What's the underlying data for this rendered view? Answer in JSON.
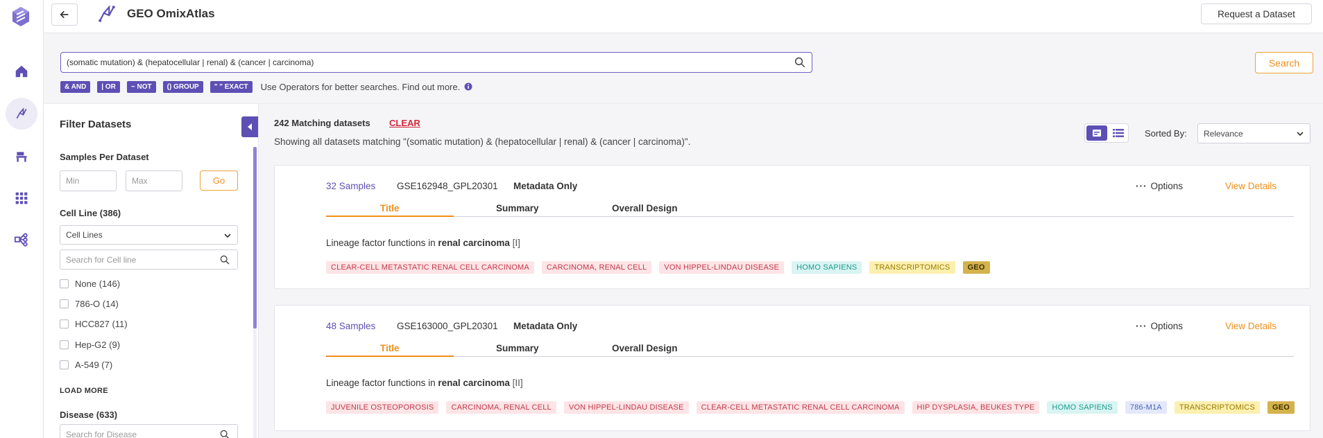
{
  "header": {
    "title": "GEO OmixAtlas",
    "request_button": "Request a Dataset"
  },
  "search": {
    "query": "(somatic mutation) & (hepatocellular | renal) & (cancer | carcinoma)",
    "button": "Search",
    "operators": [
      "& AND",
      "| OR",
      "~ NOT",
      "() GROUP",
      "\" \" EXACT"
    ],
    "help_text": "Use Operators for better searches. Find out more."
  },
  "filters": {
    "title": "Filter Datasets",
    "samples_per_dataset": {
      "label": "Samples Per Dataset",
      "min_placeholder": "Min",
      "max_placeholder": "Max",
      "go": "Go"
    },
    "cell_line": {
      "label": "Cell Line (386)",
      "select_value": "Cell Lines",
      "search_placeholder": "Search for Cell line",
      "options": [
        "None (146)",
        "786-O (14)",
        "HCC827 (11)",
        "Hep-G2 (9)",
        "A-549 (7)"
      ]
    },
    "load_more": "LOAD MORE",
    "disease": {
      "label": "Disease (633)",
      "search_placeholder": "Search for Disease"
    }
  },
  "results": {
    "count": "242 Matching datasets",
    "clear": "CLEAR",
    "showing": "Showing all datasets matching \"(somatic mutation) & (hepatocellular | renal) & (cancer | carcinoma)\".",
    "sorted_by_label": "Sorted By:",
    "sorted_by_value": "Relevance"
  },
  "cards": [
    {
      "samples": "32 Samples",
      "gse": "GSE162948_GPL20301",
      "meta": "Metadata Only",
      "options": "Options",
      "view_details": "View Details",
      "tabs": [
        "Title",
        "Summary",
        "Overall Design"
      ],
      "desc_prefix": "Lineage factor functions in ",
      "desc_bold": "renal carcinoma",
      "desc_ref": " [I]",
      "tags": [
        {
          "text": "CLEAR-CELL METASTATIC RENAL CELL CARCINOMA",
          "kind": "disease"
        },
        {
          "text": "CARCINOMA, RENAL CELL",
          "kind": "disease"
        },
        {
          "text": "VON HIPPEL-LINDAU DISEASE",
          "kind": "disease"
        },
        {
          "text": "HOMO SAPIENS",
          "kind": "species"
        },
        {
          "text": "TRANSCRIPTOMICS",
          "kind": "omics"
        },
        {
          "text": "GEO",
          "kind": "geo"
        }
      ]
    },
    {
      "samples": "48 Samples",
      "gse": "GSE163000_GPL20301",
      "meta": "Metadata Only",
      "options": "Options",
      "view_details": "View Details",
      "tabs": [
        "Title",
        "Summary",
        "Overall Design"
      ],
      "desc_prefix": "Lineage factor functions in ",
      "desc_bold": "renal carcinoma",
      "desc_ref": " [II]",
      "tags": [
        {
          "text": "JUVENILE OSTEOPOROSIS",
          "kind": "disease"
        },
        {
          "text": "CARCINOMA, RENAL CELL",
          "kind": "disease"
        },
        {
          "text": "VON HIPPEL-LINDAU DISEASE",
          "kind": "disease"
        },
        {
          "text": "CLEAR-CELL METASTATIC RENAL CELL CARCINOMA",
          "kind": "disease"
        },
        {
          "text": "HIP DYSPLASIA, BEUKES TYPE",
          "kind": "disease"
        },
        {
          "text": "HOMO SAPIENS",
          "kind": "species"
        },
        {
          "text": "786-M1A",
          "kind": "cell"
        },
        {
          "text": "TRANSCRIPTOMICS",
          "kind": "omics"
        },
        {
          "text": "GEO",
          "kind": "geo"
        }
      ]
    }
  ],
  "colors": {
    "accent": "#5e4fb5",
    "orange": "#ef8f1a",
    "clear_red": "#d22a3c"
  }
}
